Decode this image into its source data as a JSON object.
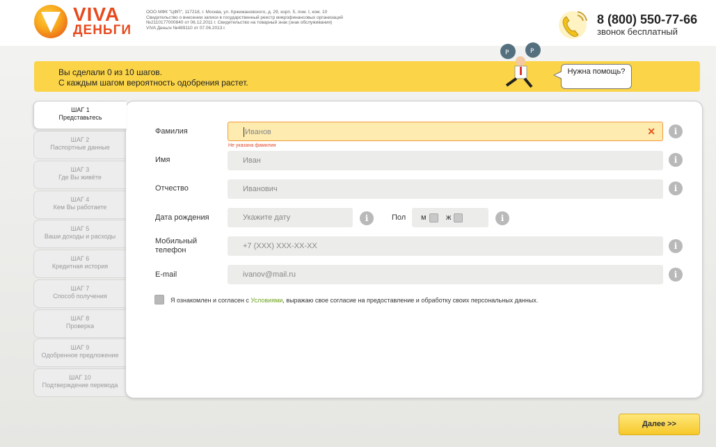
{
  "header": {
    "logo_text_1": "VIVA",
    "logo_text_2": "ДЕНЬГИ",
    "legal_lines": [
      "ООО МФК \"ЦФП\", 117218, г. Москва, ул. Кржижановского, д. 29, корп. 5, пом. I, ком. 10",
      "Свидетельство о внесении записи в государственный реестр микрофинансовых организаций",
      "№2110177000840 от 06.12.2011 г. Свидетельство на товарный знак (знак обслуживания)",
      "VIVA Деньги №489110 от 07.06.2013 г."
    ],
    "phone": "8 (800) 550-77-66",
    "phone_sub": "звонок бесплатный"
  },
  "banner": {
    "line1": "Вы сделали 0 из 10 шагов.",
    "line2": "С каждым шагом вероятность одобрения растет.",
    "help": "Нужна помощь?"
  },
  "steps": [
    {
      "num": "ШАГ 1",
      "label": "Представьтесь",
      "active": true
    },
    {
      "num": "ШАГ 2",
      "label": "Паспортные данные"
    },
    {
      "num": "ШАГ 3",
      "label": "Где Вы живёте"
    },
    {
      "num": "ШАГ 4",
      "label": "Кем Вы работаете"
    },
    {
      "num": "ШАГ 5",
      "label": "Ваши доходы и расходы"
    },
    {
      "num": "ШАГ 6",
      "label": "Кредитная история"
    },
    {
      "num": "ШАГ 7",
      "label": "Способ получения"
    },
    {
      "num": "ШАГ 8",
      "label": "Проверка"
    },
    {
      "num": "ШАГ 9",
      "label": "Одобренное предложение"
    },
    {
      "num": "ШАГ 10",
      "label": "Подтверждение перевода"
    }
  ],
  "form": {
    "surname_label": "Фамилия",
    "surname_placeholder": "Иванов",
    "surname_error": "Не указана фамилия",
    "name_label": "Имя",
    "name_placeholder": "Иван",
    "patronymic_label": "Отчество",
    "patronymic_placeholder": "Иванович",
    "birth_label": "Дата рождения",
    "birth_placeholder": "Укажите дату",
    "gender_label": "Пол",
    "gender_m": "м",
    "gender_f": "ж",
    "mobile_label_1": "Мобильный",
    "mobile_label_2": "телефон",
    "mobile_placeholder": "+7 (XXX) XXX-XX-XX",
    "email_label": "E-mail",
    "email_placeholder": "ivanov@mail.ru",
    "agree_before": "Я ознакомлен и согласен с ",
    "agree_link": "Условиями",
    "agree_after": ", выражаю свое согласие на предоставление и обработку своих персональных данных."
  },
  "next_button": "Далее >>",
  "colors": {
    "accent_yellow": "#fbd448",
    "brand_orange": "#e8491d",
    "error_bg": "#fdebb0",
    "link_green": "#6aa11a"
  }
}
